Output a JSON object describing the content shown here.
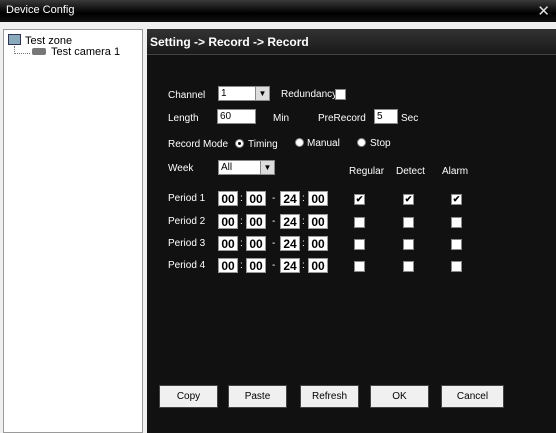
{
  "window": {
    "title": "Device Config",
    "close_glyph": "✕"
  },
  "tree": {
    "root": "Test zone",
    "child": "Test camera 1"
  },
  "panel": {
    "breadcrumb": "Setting -> Record -> Record"
  },
  "form": {
    "channel_label": "Channel",
    "channel_value": "1",
    "redundancy_label": "Redundancy",
    "redundancy_checked": false,
    "length_label": "Length",
    "length_value": "60",
    "length_unit": "Min",
    "prerecord_label": "PreRecord",
    "prerecord_value": "5",
    "prerecord_unit": "Sec",
    "record_mode_label": "Record Mode",
    "modes": [
      {
        "label": "Timing",
        "selected": true
      },
      {
        "label": "Manual",
        "selected": false
      },
      {
        "label": "Stop",
        "selected": false
      }
    ],
    "week_label": "Week",
    "week_value": "All",
    "col_headers": {
      "regular": "Regular",
      "detect": "Detect",
      "alarm": "Alarm"
    },
    "time_sep": ":",
    "range_sep": "-",
    "periods": [
      {
        "label": "Period 1",
        "start_h": "00",
        "start_m": "00",
        "end_h": "24",
        "end_m": "00",
        "regular": true,
        "detect": true,
        "alarm": true
      },
      {
        "label": "Period 2",
        "start_h": "00",
        "start_m": "00",
        "end_h": "24",
        "end_m": "00",
        "regular": false,
        "detect": false,
        "alarm": false
      },
      {
        "label": "Period 3",
        "start_h": "00",
        "start_m": "00",
        "end_h": "24",
        "end_m": "00",
        "regular": false,
        "detect": false,
        "alarm": false
      },
      {
        "label": "Period 4",
        "start_h": "00",
        "start_m": "00",
        "end_h": "24",
        "end_m": "00",
        "regular": false,
        "detect": false,
        "alarm": false
      }
    ]
  },
  "buttons": {
    "copy": "Copy",
    "paste": "Paste",
    "refresh": "Refresh",
    "ok": "OK",
    "cancel": "Cancel"
  },
  "icons": {
    "zone": "folder-video-icon",
    "camera": "camera-icon",
    "dropdown": "chevron-down-icon",
    "check_glyph": "✔"
  }
}
